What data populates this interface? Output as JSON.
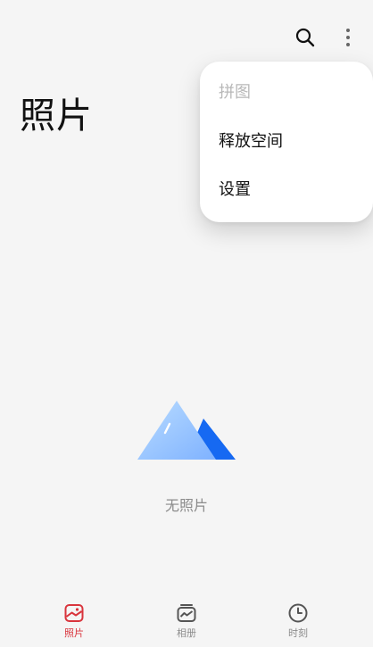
{
  "app": {
    "title": "照片"
  },
  "toolbar": {
    "search_icon": "search-icon",
    "more_icon": "more-vertical-icon"
  },
  "menu": {
    "items": [
      {
        "label": "拼图",
        "enabled": false
      },
      {
        "label": "释放空间",
        "enabled": true
      },
      {
        "label": "设置",
        "enabled": true
      }
    ]
  },
  "empty_state": {
    "text": "无照片",
    "illustration": "mountains-icon"
  },
  "bottom_nav": {
    "items": [
      {
        "label": "照片",
        "icon": "photo-icon",
        "active": true
      },
      {
        "label": "相册",
        "icon": "album-icon",
        "active": false
      },
      {
        "label": "时刻",
        "icon": "clock-icon",
        "active": false
      }
    ]
  },
  "colors": {
    "background": "#f5f5f5",
    "accent": "#d9353d",
    "menu_bg": "#ffffff",
    "inactive_text": "#8c8c8c",
    "disabled_text": "#b8b8b8",
    "illustration_blue": "#1669f2",
    "illustration_light_blue": "#8dc0ff"
  }
}
